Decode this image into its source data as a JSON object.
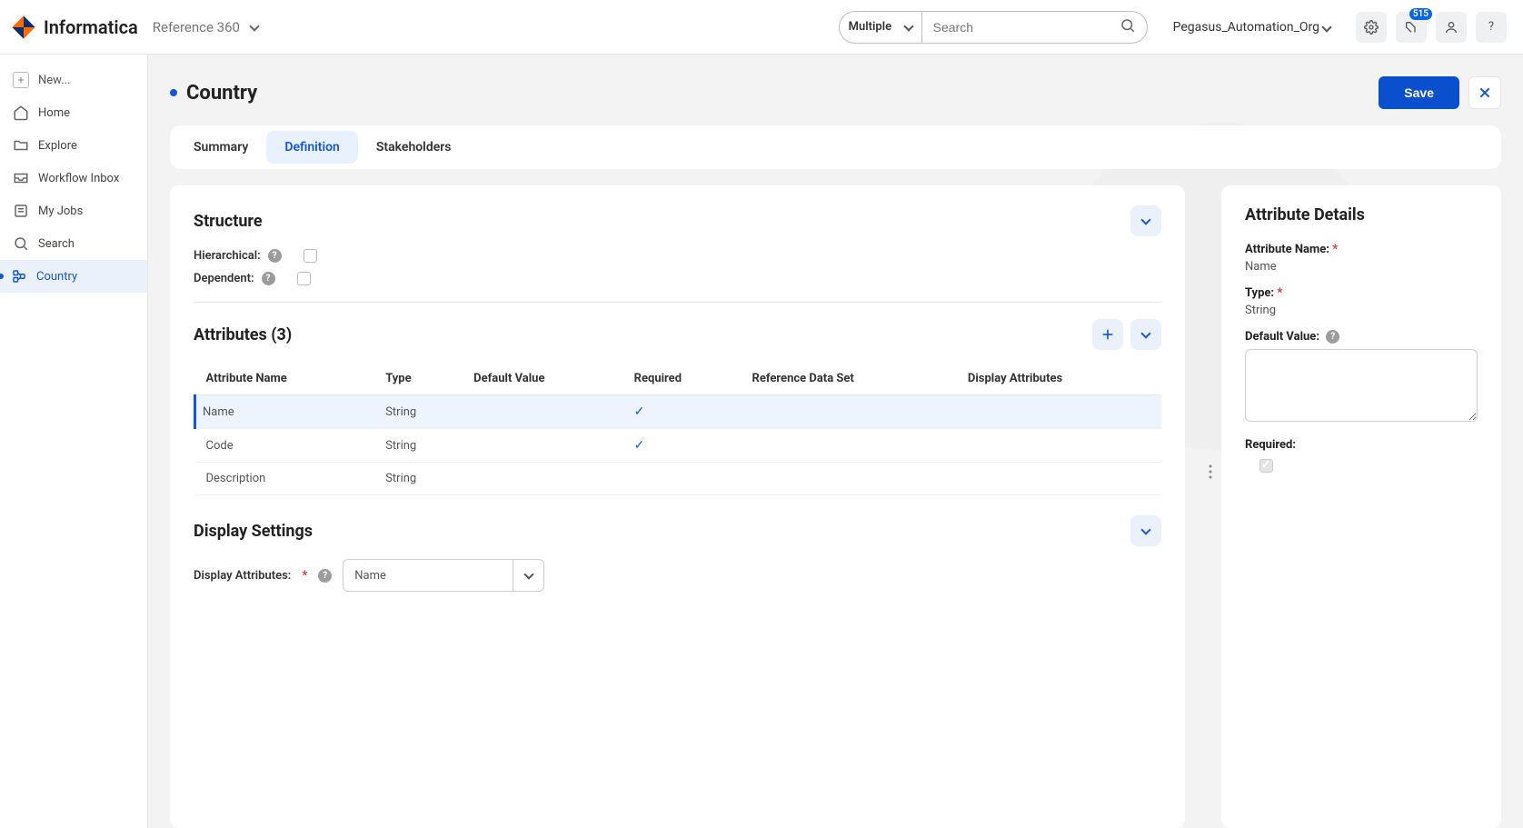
{
  "header": {
    "brand": "Informatica",
    "app_name": "Reference 360",
    "search_scope": "Multiple",
    "search_placeholder": "Search",
    "org_name": "Pegasus_Automation_Org",
    "notif_count": "515"
  },
  "sidebar": {
    "items": [
      {
        "label": "New..."
      },
      {
        "label": "Home"
      },
      {
        "label": "Explore"
      },
      {
        "label": "Workflow Inbox"
      },
      {
        "label": "My Jobs"
      },
      {
        "label": "Search"
      },
      {
        "label": "Country"
      }
    ]
  },
  "page": {
    "title": "Country",
    "save_label": "Save",
    "tabs": [
      {
        "label": "Summary"
      },
      {
        "label": "Definition"
      },
      {
        "label": "Stakeholders"
      }
    ]
  },
  "structure": {
    "title": "Structure",
    "hierarchical_label": "Hierarchical:",
    "dependent_label": "Dependent:"
  },
  "attributes": {
    "title": "Attributes (3)",
    "columns": {
      "name": "Attribute Name",
      "type": "Type",
      "default": "Default Value",
      "required": "Required",
      "refset": "Reference Data Set",
      "display": "Display Attributes"
    },
    "rows": [
      {
        "name": "Name",
        "type": "String",
        "default": "",
        "required": true,
        "refset": "",
        "display": ""
      },
      {
        "name": "Code",
        "type": "String",
        "default": "",
        "required": true,
        "refset": "",
        "display": ""
      },
      {
        "name": "Description",
        "type": "String",
        "default": "",
        "required": false,
        "refset": "",
        "display": ""
      }
    ]
  },
  "display_settings": {
    "title": "Display Settings",
    "label": "Display Attributes:",
    "value": "Name"
  },
  "details": {
    "title": "Attribute Details",
    "name_label": "Attribute Name:",
    "name_value": "Name",
    "type_label": "Type:",
    "type_value": "String",
    "default_label": "Default Value:",
    "default_value": "",
    "required_label": "Required:"
  }
}
